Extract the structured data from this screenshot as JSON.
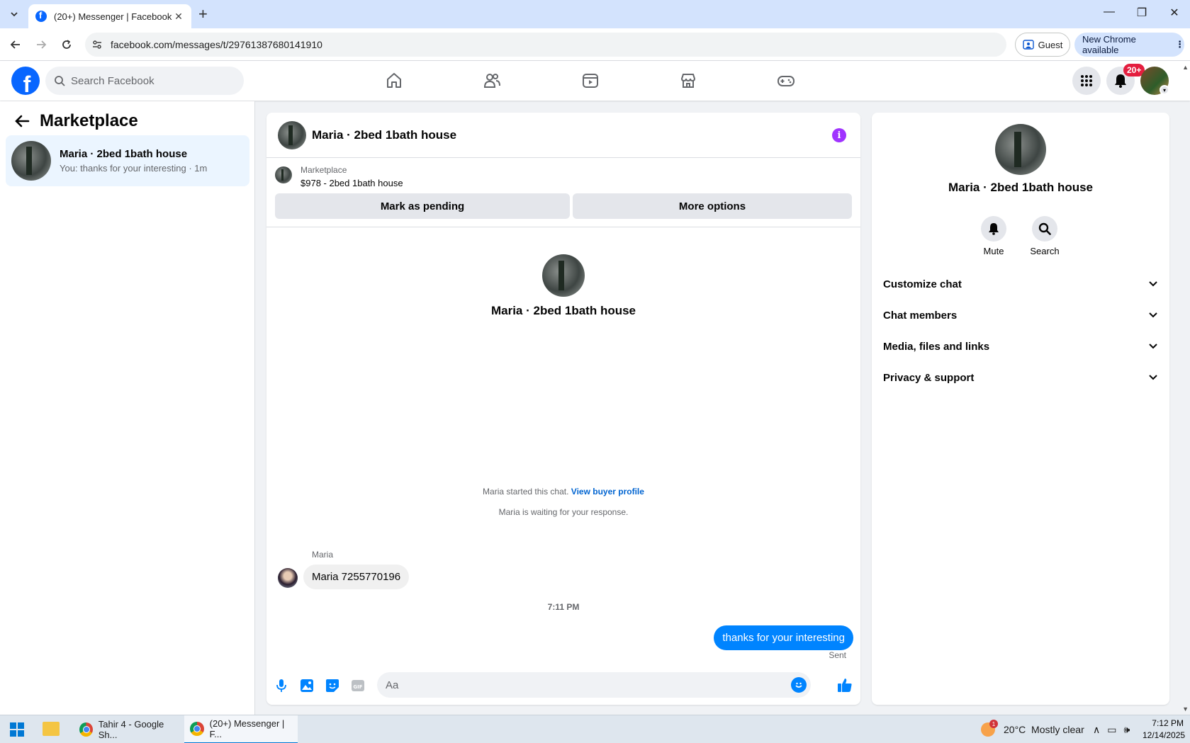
{
  "browser": {
    "tab_title": "(20+) Messenger | Facebook",
    "url": "facebook.com/messages/t/29761387680141910",
    "guest_label": "Guest",
    "update_label": "New Chrome available"
  },
  "fb": {
    "search_placeholder": "Search Facebook",
    "notification_count": "20+",
    "brand_color": "#0866ff"
  },
  "left": {
    "title": "Marketplace",
    "conversation": {
      "name": "Maria · 2bed 1bath house",
      "preview": "You: thanks for your interesting · 1m"
    }
  },
  "chat": {
    "header_name": "Maria · 2bed 1bath house",
    "listing_source": "Marketplace",
    "listing_title": "$978 - 2bed 1bath house",
    "mark_pending_label": "Mark as pending",
    "more_options_label": "More options",
    "center_name": "Maria · 2bed 1bath house",
    "started_text": "Maria started this chat.",
    "view_buyer_label": "View buyer profile",
    "waiting_text": "Maria is waiting for your response.",
    "sender_name": "Maria",
    "incoming_message": "Maria 7255770196",
    "timestamp": "7:11 PM",
    "outgoing_message": "thanks for your interesting",
    "sent_label": "Sent",
    "input_placeholder": "Aa",
    "accent_color": "#0084ff"
  },
  "details": {
    "name": "Maria · 2bed 1bath house",
    "mute_label": "Mute",
    "search_label": "Search",
    "sections": [
      "Customize chat",
      "Chat members",
      "Media, files and links",
      "Privacy & support"
    ]
  },
  "taskbar": {
    "app1": "Tahir 4 - Google Sh...",
    "app2": "(20+) Messenger | F...",
    "weather": "20°C  Mostly clear",
    "time": "7:12 PM",
    "date": "12/14/2025"
  }
}
